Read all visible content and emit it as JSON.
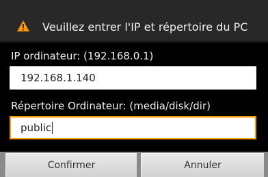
{
  "dialog": {
    "title": "Veuillez entrer l'IP et répertoire du PC",
    "ip_label": "IP ordinateur: (192.168.0.1)",
    "ip_value": "192.168.1.140",
    "dir_label": "Répertoire Ordinateur: (media/disk/dir)",
    "dir_value": "public",
    "confirm_label": "Confirmer",
    "cancel_label": "Annuler",
    "icon": "warning-icon",
    "accent_color": "#ff9c00",
    "warning_color": "#ff9900"
  }
}
